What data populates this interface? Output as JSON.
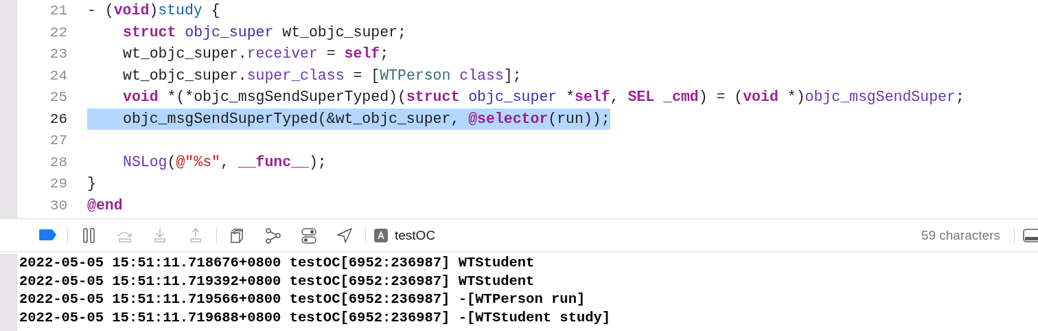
{
  "editor": {
    "lines": [
      {
        "number": "21",
        "highlighted": false,
        "indented": false,
        "tokens": [
          {
            "text": "- (",
            "kind": "plain"
          },
          {
            "text": "void",
            "kind": "keyword"
          },
          {
            "text": ")",
            "kind": "plain"
          },
          {
            "text": "study",
            "kind": "declaration"
          },
          {
            "text": " {",
            "kind": "plain"
          }
        ]
      },
      {
        "number": "22",
        "highlighted": false,
        "indented": true,
        "tokens": [
          {
            "text": "struct",
            "kind": "keyword"
          },
          {
            "text": " objc_super",
            "kind": "type"
          },
          {
            "text": " wt_objc_super;",
            "kind": "plain"
          }
        ]
      },
      {
        "number": "23",
        "highlighted": false,
        "indented": true,
        "tokens": [
          {
            "text": "wt_objc_super.",
            "kind": "plain"
          },
          {
            "text": "receiver",
            "kind": "property"
          },
          {
            "text": " = ",
            "kind": "plain"
          },
          {
            "text": "self",
            "kind": "keyword"
          },
          {
            "text": ";",
            "kind": "plain"
          }
        ]
      },
      {
        "number": "24",
        "highlighted": false,
        "indented": true,
        "tokens": [
          {
            "text": "wt_objc_super.",
            "kind": "plain"
          },
          {
            "text": "super_class",
            "kind": "property"
          },
          {
            "text": " = [",
            "kind": "plain"
          },
          {
            "text": "WTPerson",
            "kind": "class"
          },
          {
            "text": " class",
            "kind": "property"
          },
          {
            "text": "];",
            "kind": "plain"
          }
        ]
      },
      {
        "number": "25",
        "highlighted": false,
        "indented": true,
        "tokens": [
          {
            "text": "void",
            "kind": "keyword"
          },
          {
            "text": " *(*objc_msgSendSuperTyped)(",
            "kind": "plain"
          },
          {
            "text": "struct",
            "kind": "keyword"
          },
          {
            "text": " objc_super",
            "kind": "type"
          },
          {
            "text": " *",
            "kind": "plain"
          },
          {
            "text": "self",
            "kind": "keyword"
          },
          {
            "text": ", ",
            "kind": "plain"
          },
          {
            "text": "SEL",
            "kind": "keyword"
          },
          {
            "text": " _cmd",
            "kind": "keyword"
          },
          {
            "text": ") = (",
            "kind": "plain"
          },
          {
            "text": "void",
            "kind": "keyword"
          },
          {
            "text": " *)",
            "kind": "plain"
          },
          {
            "text": "objc_msgSendSuper",
            "kind": "property"
          },
          {
            "text": ";",
            "kind": "plain"
          }
        ]
      },
      {
        "number": "26",
        "highlighted": true,
        "indented": true,
        "tokens": [
          {
            "text": "objc_msgSendSuperTyped(&wt_objc_super, ",
            "kind": "plain"
          },
          {
            "text": "@selector",
            "kind": "keyword"
          },
          {
            "text": "(run));",
            "kind": "plain"
          }
        ]
      },
      {
        "number": "27"
      },
      {
        "number": "28",
        "highlighted": false,
        "indented": true,
        "tokens": [
          {
            "text": "NSLog",
            "kind": "property"
          },
          {
            "text": "(",
            "kind": "plain"
          },
          {
            "text": "@\"%s\"",
            "kind": "string"
          },
          {
            "text": ", ",
            "kind": "plain"
          },
          {
            "text": "__func__",
            "kind": "keyword"
          },
          {
            "text": ");",
            "kind": "plain"
          }
        ]
      },
      {
        "number": "29",
        "highlighted": false,
        "indented": false,
        "tokens": [
          {
            "text": "}",
            "kind": "plain"
          }
        ]
      },
      {
        "number": "30",
        "highlighted": false,
        "indented": false,
        "tokens": [
          {
            "text": "@end",
            "kind": "keyword"
          }
        ]
      }
    ]
  },
  "debug_bar": {
    "buttons": [
      {
        "kind": "breakpoints",
        "on": true,
        "disabled": false
      },
      {
        "kind": "pause",
        "on": false,
        "disabled": false
      },
      {
        "kind": "step-over",
        "on": false,
        "disabled": true
      },
      {
        "kind": "step-into",
        "on": false,
        "disabled": true
      },
      {
        "kind": "step-out",
        "on": false,
        "disabled": true
      },
      {
        "kind": "view-hierarchy",
        "on": false,
        "disabled": false
      },
      {
        "kind": "memory-graph",
        "on": false,
        "disabled": false
      },
      {
        "kind": "environment",
        "on": false,
        "disabled": false
      },
      {
        "kind": "location",
        "on": false,
        "disabled": false
      }
    ],
    "target": "testOC",
    "char_count": "59 characters"
  },
  "console": {
    "lines": [
      "2022-05-05 15:51:11.718676+0800 testOC[6952:236987] WTStudent",
      "2022-05-05 15:51:11.719392+0800 testOC[6952:236987] WTStudent",
      "2022-05-05 15:51:11.719566+0800 testOC[6952:236987] -[WTPerson run]",
      "2022-05-05 15:51:11.719688+0800 testOC[6952:236987] -[WTStudent study]"
    ]
  }
}
